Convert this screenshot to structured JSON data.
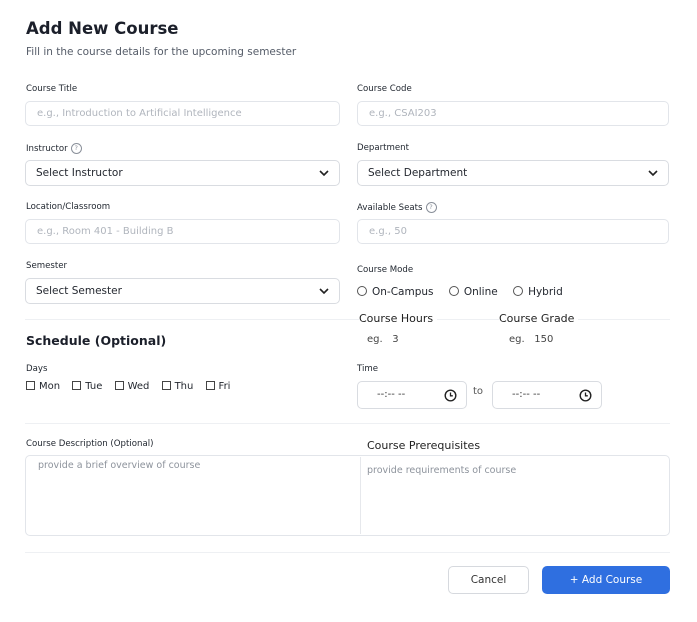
{
  "header": {
    "title": "Add New Course",
    "subtitle": "Fill in the course details for the upcoming semester"
  },
  "fields": {
    "course_title": {
      "label": "Course Title",
      "placeholder": "e.g., Introduction to Artificial Intelligence"
    },
    "course_code": {
      "label": "Course Code",
      "placeholder": "e.g., CSAI203"
    },
    "instructor": {
      "label": "Instructor",
      "value": "Select Instructor"
    },
    "department": {
      "label": "Department",
      "value": "Select Department"
    },
    "location": {
      "label": "Location/Classroom",
      "placeholder": "e.g., Room 401 - Building B"
    },
    "seats": {
      "label": "Available Seats",
      "placeholder": "e.g., 50"
    },
    "semester": {
      "label": "Semester",
      "value": "Select Semester"
    },
    "course_mode": {
      "label": "Course Mode",
      "options": [
        "On-Campus",
        "Online",
        "Hybrid"
      ]
    },
    "course_hours": {
      "label": "Course Hours",
      "hint": "eg.   3"
    },
    "course_grade": {
      "label": "Course Grade",
      "hint": "eg.   150"
    }
  },
  "schedule": {
    "heading": "Schedule (Optional)",
    "days_label": "Days",
    "days": [
      "Mon",
      "Tue",
      "Wed",
      "Thu",
      "Fri"
    ],
    "time_label": "Time",
    "time_start": "--:-- --",
    "time_sep": "to",
    "time_end": "--:-- --"
  },
  "description": {
    "label": "Course Description (Optional)",
    "placeholder": "provide a brief overview of course"
  },
  "prerequisites": {
    "label": "Course Prerequisites",
    "placeholder": "provide requirements of course"
  },
  "actions": {
    "cancel": "Cancel",
    "add": "+ Add Course"
  },
  "colors": {
    "accent": "#2f6fe0"
  }
}
